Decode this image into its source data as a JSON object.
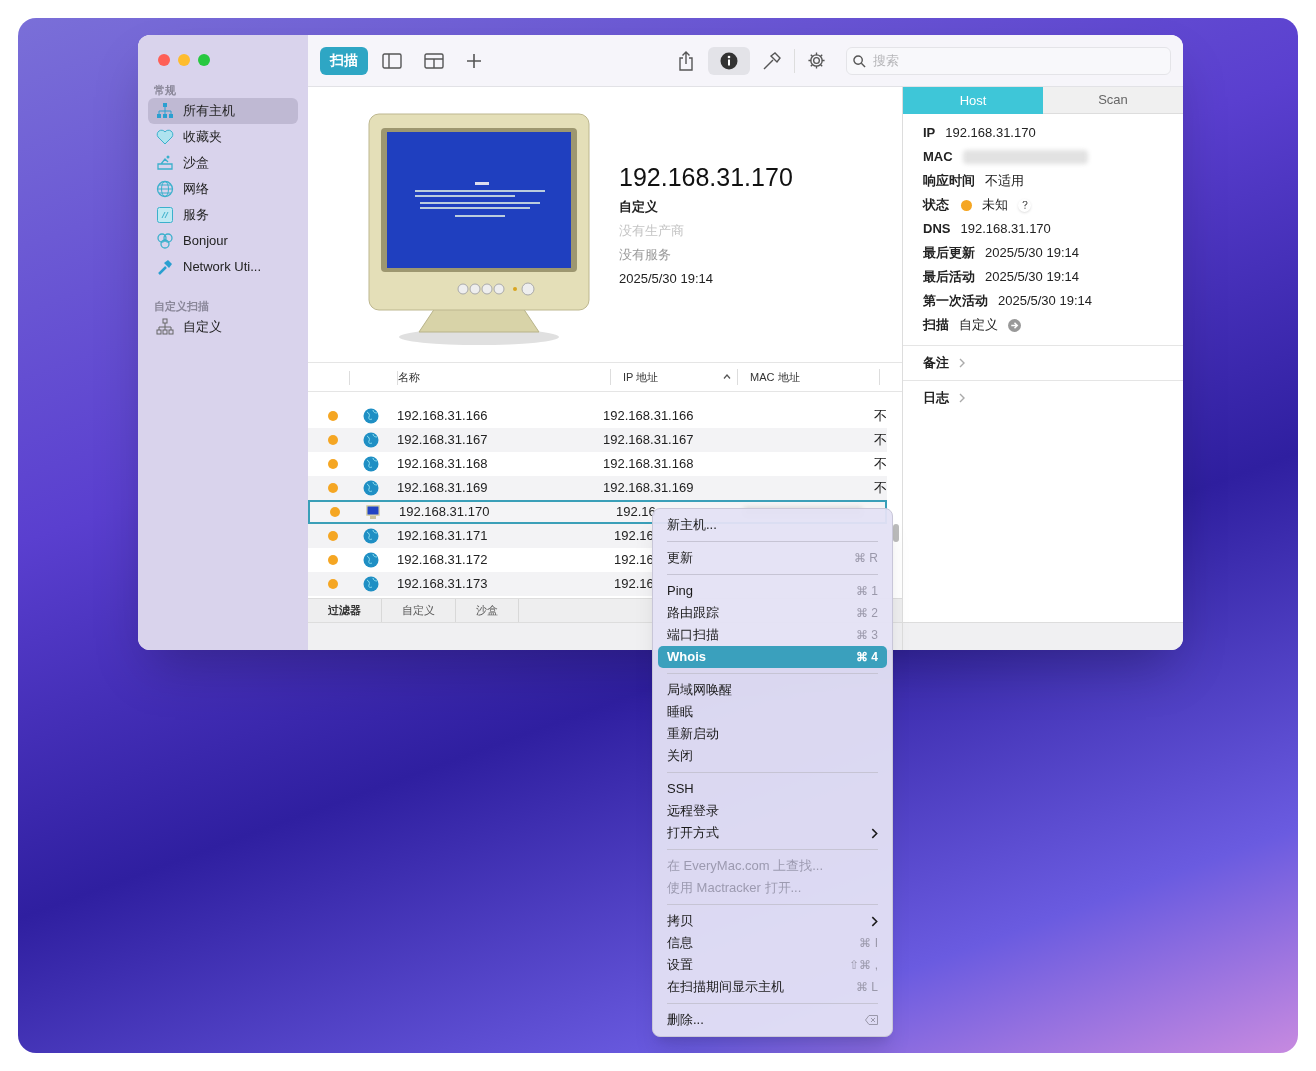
{
  "sidebar": {
    "sections": [
      {
        "heading": "常规",
        "items": [
          {
            "label": "所有主机",
            "selected": true
          },
          {
            "label": "收藏夹",
            "selected": false
          },
          {
            "label": "沙盒",
            "selected": false
          },
          {
            "label": "网络",
            "selected": false
          },
          {
            "label": "服务",
            "selected": false
          },
          {
            "label": "Bonjour",
            "selected": false
          },
          {
            "label": "Network Uti...",
            "selected": false
          }
        ]
      },
      {
        "heading": "自定义扫描",
        "items": [
          {
            "label": "自定义",
            "selected": false
          }
        ]
      }
    ]
  },
  "toolbar": {
    "scan_button": "扫描",
    "info_selected": true,
    "search": {
      "placeholder": "搜索"
    }
  },
  "host_header": {
    "title": "192.168.31.170",
    "scan": "自定义",
    "vendor": "没有生产商",
    "services": "没有服务",
    "date": "2025/5/30 19:14"
  },
  "table": {
    "columns": [
      "名称",
      "IP 地址",
      "MAC 地址"
    ],
    "rows": [
      {
        "kind": "globe",
        "name": "192.168.31.166",
        "ip": "192.168.31.166",
        "column_4": "不",
        "selected": false
      },
      {
        "kind": "globe",
        "name": "192.168.31.167",
        "ip": "192.168.31.167",
        "column_4": "不",
        "selected": false
      },
      {
        "kind": "globe",
        "name": "192.168.31.168",
        "ip": "192.168.31.168",
        "column_4": "不",
        "selected": false
      },
      {
        "kind": "globe",
        "name": "192.168.31.169",
        "ip": "192.168.31.169",
        "column_4": "不",
        "selected": false
      },
      {
        "kind": "monitor",
        "name": "192.168.31.170",
        "ip": "192.16",
        "mac_redacted": true,
        "selected": true
      },
      {
        "kind": "globe",
        "name": "192.168.31.171",
        "ip": "192.16",
        "selected": false
      },
      {
        "kind": "globe",
        "name": "192.168.31.172",
        "ip": "192.16",
        "selected": false
      },
      {
        "kind": "globe",
        "name": "192.168.31.173",
        "ip": "192.16",
        "selected": false
      }
    ]
  },
  "bottom_tabs": [
    {
      "label": "过滤器",
      "selected": true
    },
    {
      "label": "自定义",
      "selected": false
    },
    {
      "label": "沙盒",
      "selected": false
    }
  ],
  "inspector": {
    "tabs": [
      {
        "label": "Host",
        "selected": true
      },
      {
        "label": "Scan",
        "selected": false
      }
    ],
    "fields": [
      {
        "kind": "text",
        "label": "IP",
        "value": "192.168.31.170"
      },
      {
        "kind": "redacted",
        "label": "MAC"
      },
      {
        "kind": "text",
        "label": "响应时间",
        "value": "不适用"
      },
      {
        "kind": "status",
        "label": "状态",
        "value": "未知",
        "color": "#f5a623"
      },
      {
        "kind": "text",
        "label": "DNS",
        "value": "192.168.31.170"
      },
      {
        "kind": "text",
        "label": "最后更新",
        "value": "2025/5/30 19:14"
      },
      {
        "kind": "text",
        "label": "最后活动",
        "value": "2025/5/30 19:14"
      },
      {
        "kind": "text",
        "label": "第一次活动",
        "value": "2025/5/30 19:14"
      },
      {
        "kind": "link",
        "label": "扫描",
        "value": "自定义"
      }
    ],
    "sections": [
      "备注",
      "日志"
    ]
  },
  "context_menu": [
    {
      "kind": "item",
      "label": "新主机...",
      "disabled": false,
      "selected": false
    },
    {
      "kind": "separator"
    },
    {
      "kind": "item",
      "label": "更新",
      "shortcut": "⌘ R",
      "disabled": false,
      "selected": false
    },
    {
      "kind": "separator"
    },
    {
      "kind": "item",
      "label": "Ping",
      "shortcut": "⌘ 1",
      "disabled": false,
      "selected": false
    },
    {
      "kind": "item",
      "label": "路由跟踪",
      "shortcut": "⌘ 2",
      "disabled": false,
      "selected": false
    },
    {
      "kind": "item",
      "label": "端口扫描",
      "shortcut": "⌘ 3",
      "disabled": false,
      "selected": false
    },
    {
      "kind": "item",
      "label": "Whois",
      "shortcut": "⌘ 4",
      "disabled": false,
      "selected": true
    },
    {
      "kind": "separator"
    },
    {
      "kind": "item",
      "label": "局域网唤醒",
      "disabled": false,
      "selected": false
    },
    {
      "kind": "item",
      "label": "睡眠",
      "disabled": false,
      "selected": false
    },
    {
      "kind": "item",
      "label": "重新启动",
      "disabled": false,
      "selected": false
    },
    {
      "kind": "item",
      "label": "关闭",
      "disabled": false,
      "selected": false
    },
    {
      "kind": "separator"
    },
    {
      "kind": "item",
      "label": "SSH",
      "disabled": false,
      "selected": false
    },
    {
      "kind": "item",
      "label": "远程登录",
      "disabled": false,
      "selected": false
    },
    {
      "kind": "submenu",
      "label": "打开方式",
      "disabled": false,
      "selected": false
    },
    {
      "kind": "separator"
    },
    {
      "kind": "item",
      "label": "在 EveryMac.com 上查找...",
      "disabled": true,
      "selected": false
    },
    {
      "kind": "item",
      "label": "使用 Mactracker 打开...",
      "disabled": true,
      "selected": false
    },
    {
      "kind": "separator"
    },
    {
      "kind": "submenu",
      "label": "拷贝",
      "disabled": false,
      "selected": false
    },
    {
      "kind": "item",
      "label": "信息",
      "shortcut": "⌘ I",
      "disabled": false,
      "selected": false
    },
    {
      "kind": "item",
      "label": "设置",
      "shortcut": "⇧⌘ ,",
      "disabled": false,
      "selected": false
    },
    {
      "kind": "item",
      "label": "在扫描期间显示主机",
      "shortcut": "⌘ L",
      "disabled": false,
      "selected": false
    },
    {
      "kind": "separator"
    },
    {
      "kind": "delete",
      "label": "删除...",
      "disabled": false,
      "selected": false
    }
  ]
}
